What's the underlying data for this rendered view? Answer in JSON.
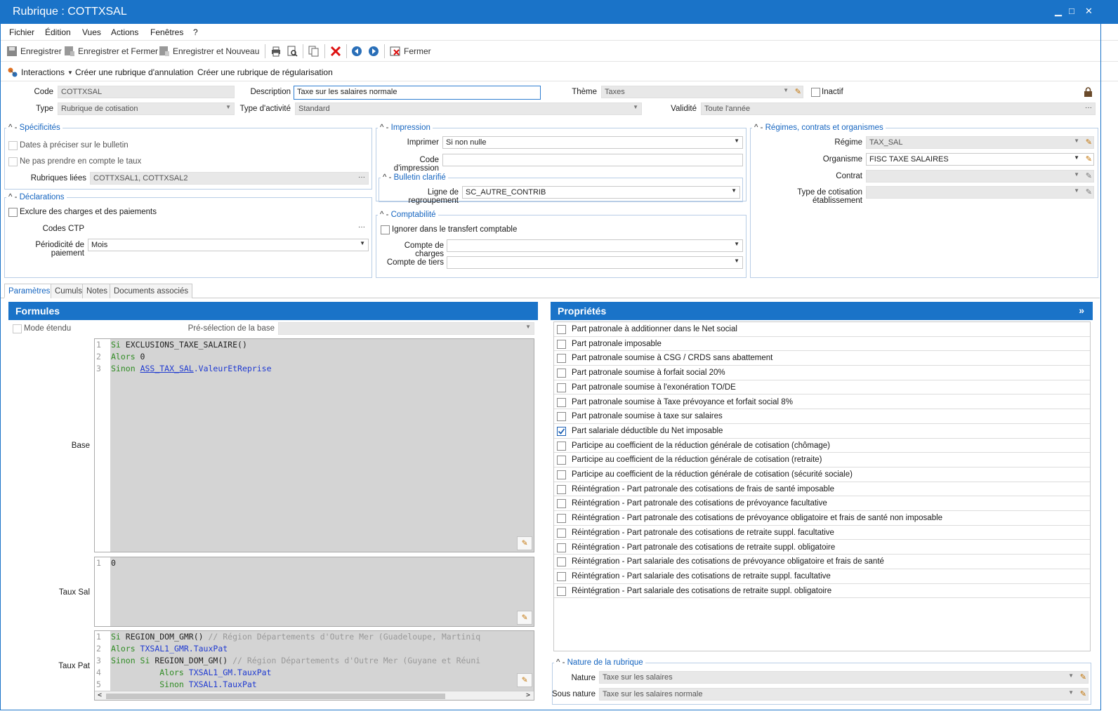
{
  "window": {
    "title": "Rubrique : COTTXSAL",
    "minimize": "▁",
    "maximize": "□",
    "close": "✕"
  },
  "menu": [
    "Fichier",
    "Édition",
    "Vues",
    "Actions",
    "Fenêtres",
    "?"
  ],
  "toolbar": {
    "save": "Enregistrer",
    "save_close": "Enregistrer et Fermer",
    "save_new": "Enregistrer et Nouveau",
    "close": "Fermer"
  },
  "actionbar": {
    "interactions": "Interactions",
    "cancel_rubric": "Créer une rubrique d'annulation",
    "regul_rubric": "Créer une rubrique de régularisation"
  },
  "header": {
    "code_label": "Code",
    "code": "COTTXSAL",
    "description_label": "Description",
    "description": "Taxe sur les salaires normale",
    "theme_label": "Thème",
    "theme": "Taxes",
    "inactive_label": "Inactif",
    "type_label": "Type",
    "type": "Rubrique de cotisation",
    "activity_label": "Type d'activité",
    "activity": "Standard",
    "validity_label": "Validité",
    "validity": "Toute l'année"
  },
  "specificites": {
    "title": "Spécificités",
    "dates": "Dates à préciser sur le bulletin",
    "taux": "Ne pas prendre en compte le taux",
    "linked_label": "Rubriques liées",
    "linked": "COTTXSAL1, COTTXSAL2",
    "ellipsis": "···"
  },
  "declarations": {
    "title": "Déclarations",
    "exclude": "Exclure des charges et des paiements",
    "ctp_label": "Codes CTP",
    "periodicity_label": "Périodicité de paiement",
    "periodicity": "Mois"
  },
  "impression": {
    "title": "Impression",
    "print_label": "Imprimer",
    "print": "Si non nulle",
    "code_label": "Code d'impression",
    "clarified_title": "Bulletin clarifié",
    "group_label": "Ligne de regroupement",
    "group": "SC_AUTRE_CONTRIB"
  },
  "comptabilite": {
    "title": "Comptabilité",
    "ignore": "Ignorer dans le transfert comptable",
    "charges_label": "Compte de charges",
    "tiers_label": "Compte de tiers"
  },
  "regimes": {
    "title": "Régimes, contrats et organismes",
    "regime_label": "Régime",
    "regime": "TAX_SAL",
    "org_label": "Organisme",
    "org": "FISC TAXE SALAIRES",
    "contract_label": "Contrat",
    "type_label": "Type de cotisation établissement"
  },
  "tabs": [
    "Paramètres",
    "Cumuls",
    "Notes",
    "Documents associés"
  ],
  "formules": {
    "title": "Formules",
    "extended_mode": "Mode étendu",
    "preselect_label": "Pré-sélection de la base",
    "base_label": "Base",
    "taux_sal_label": "Taux Sal",
    "taux_pat_label": "Taux Pat",
    "base_code": [
      {
        "n": "1",
        "kw": "Si",
        "rest": " EXCLUSIONS_TAXE_SALAIRE()"
      },
      {
        "n": "2",
        "kw": "Alors",
        "rest": " 0"
      },
      {
        "n": "3",
        "kw": "Sinon",
        "ref": "ASS_TAX_SAL",
        "rest": ".ValeurEtReprise"
      }
    ],
    "sal_code": [
      {
        "n": "1",
        "text": "0"
      }
    ],
    "pat_code": [
      {
        "n": "1",
        "kw": "Si",
        "fn": " REGION_DOM_GMR()",
        "cm": " // Région Départements d'Outre Mer (Guadeloupe, Martiniq"
      },
      {
        "n": "2",
        "kw": "Alors",
        "ref": " TXSAL1_GMR.TauxPat"
      },
      {
        "n": "3",
        "kw": "Sinon Si",
        "fn": " REGION_DOM_GM()",
        "cm": " // Région Départements d'Outre Mer (Guyane et Réuni"
      },
      {
        "n": "4",
        "kw": "          Alors",
        "ref": " TXSAL1_GM.TauxPat"
      },
      {
        "n": "5",
        "kw": "          Sinon",
        "ref": " TXSAL1.TauxPat"
      }
    ]
  },
  "proprietes": {
    "title": "Propriétés",
    "expand": "»",
    "items": [
      {
        "label": "Part patronale à additionner dans le Net social",
        "checked": false
      },
      {
        "label": "Part patronale imposable",
        "checked": false
      },
      {
        "label": "Part patronale soumise à CSG / CRDS sans abattement",
        "checked": false
      },
      {
        "label": "Part patronale soumise à forfait social 20%",
        "checked": false
      },
      {
        "label": "Part patronale soumise à l'exonération TO/DE",
        "checked": false
      },
      {
        "label": "Part patronale soumise à Taxe prévoyance et forfait social 8%",
        "checked": false
      },
      {
        "label": "Part patronale soumise à taxe sur salaires",
        "checked": false
      },
      {
        "label": "Part salariale déductible du Net imposable",
        "checked": true
      },
      {
        "label": "Participe au coefficient de la réduction générale de cotisation (chômage)",
        "checked": false
      },
      {
        "label": "Participe au coefficient de la réduction générale de cotisation (retraite)",
        "checked": false
      },
      {
        "label": "Participe au coefficient de la réduction générale de cotisation (sécurité sociale)",
        "checked": false
      },
      {
        "label": "Réintégration - Part patronale des cotisations de frais de santé imposable",
        "checked": false
      },
      {
        "label": "Réintégration - Part patronale des cotisations de prévoyance facultative",
        "checked": false
      },
      {
        "label": "Réintégration - Part patronale des cotisations de prévoyance obligatoire et frais de santé non imposable",
        "checked": false
      },
      {
        "label": "Réintégration - Part patronale des cotisations de retraite suppl. facultative",
        "checked": false
      },
      {
        "label": "Réintégration - Part patronale des cotisations de retraite suppl. obligatoire",
        "checked": false
      },
      {
        "label": "Réintégration - Part salariale des cotisations de prévoyance obligatoire et frais de santé",
        "checked": false
      },
      {
        "label": "Réintégration - Part salariale des cotisations de retraite suppl. facultative",
        "checked": false
      },
      {
        "label": "Réintégration - Part salariale des cotisations de retraite suppl. obligatoire",
        "checked": false
      }
    ]
  },
  "nature": {
    "title": "Nature de la rubrique",
    "nature_label": "Nature",
    "nature": "Taxe sur les salaires",
    "sub_label": "Sous nature",
    "sub": "Taxe sur les salaires normale"
  },
  "colors": {
    "accent": "#1a73c8",
    "group_title": "#1565c0"
  }
}
